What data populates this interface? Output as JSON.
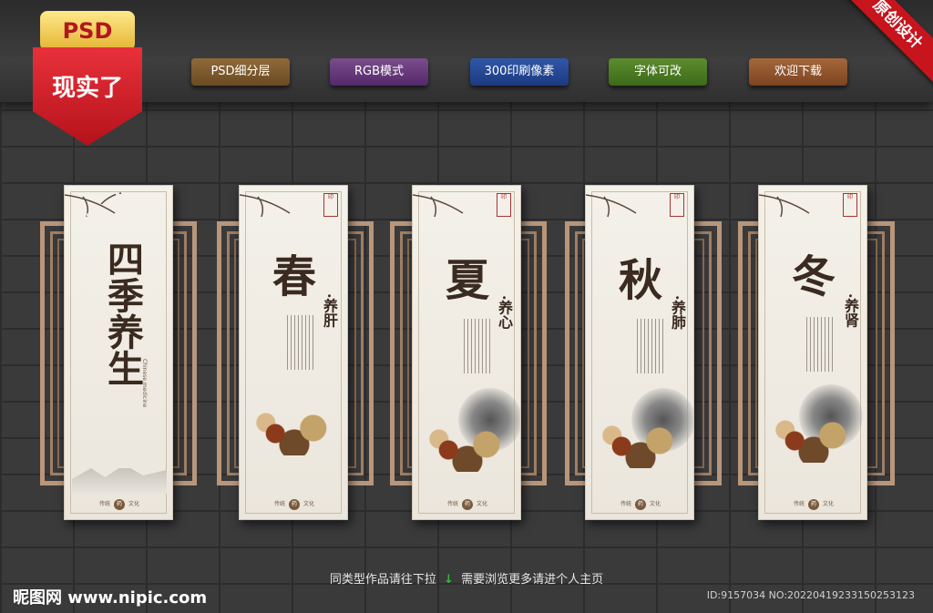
{
  "badge": {
    "top": "PSD",
    "main": "现实了"
  },
  "corner_ribbon": "原创设计",
  "tags": [
    "PSD细分层",
    "RGB模式",
    "300印刷像素",
    "字体可改",
    "欢迎下载"
  ],
  "panels": [
    {
      "title": "四季养生",
      "sub": "",
      "en": "Chinese medicine"
    },
    {
      "title": "春",
      "sub": "·养肝"
    },
    {
      "title": "夏",
      "sub": "·养心"
    },
    {
      "title": "秋",
      "sub": "·养肺"
    },
    {
      "title": "冬",
      "sub": "·养肾"
    }
  ],
  "panel_footer": {
    "left": "传统",
    "stamp": "药",
    "right": "文化"
  },
  "bottom": {
    "left": "同类型作品请往下拉",
    "right": "需要浏览更多请进个人主页"
  },
  "watermark": {
    "logo": "昵图网 www.nipic.com",
    "id": "ID:9157034 NO:20220419233150253123"
  }
}
